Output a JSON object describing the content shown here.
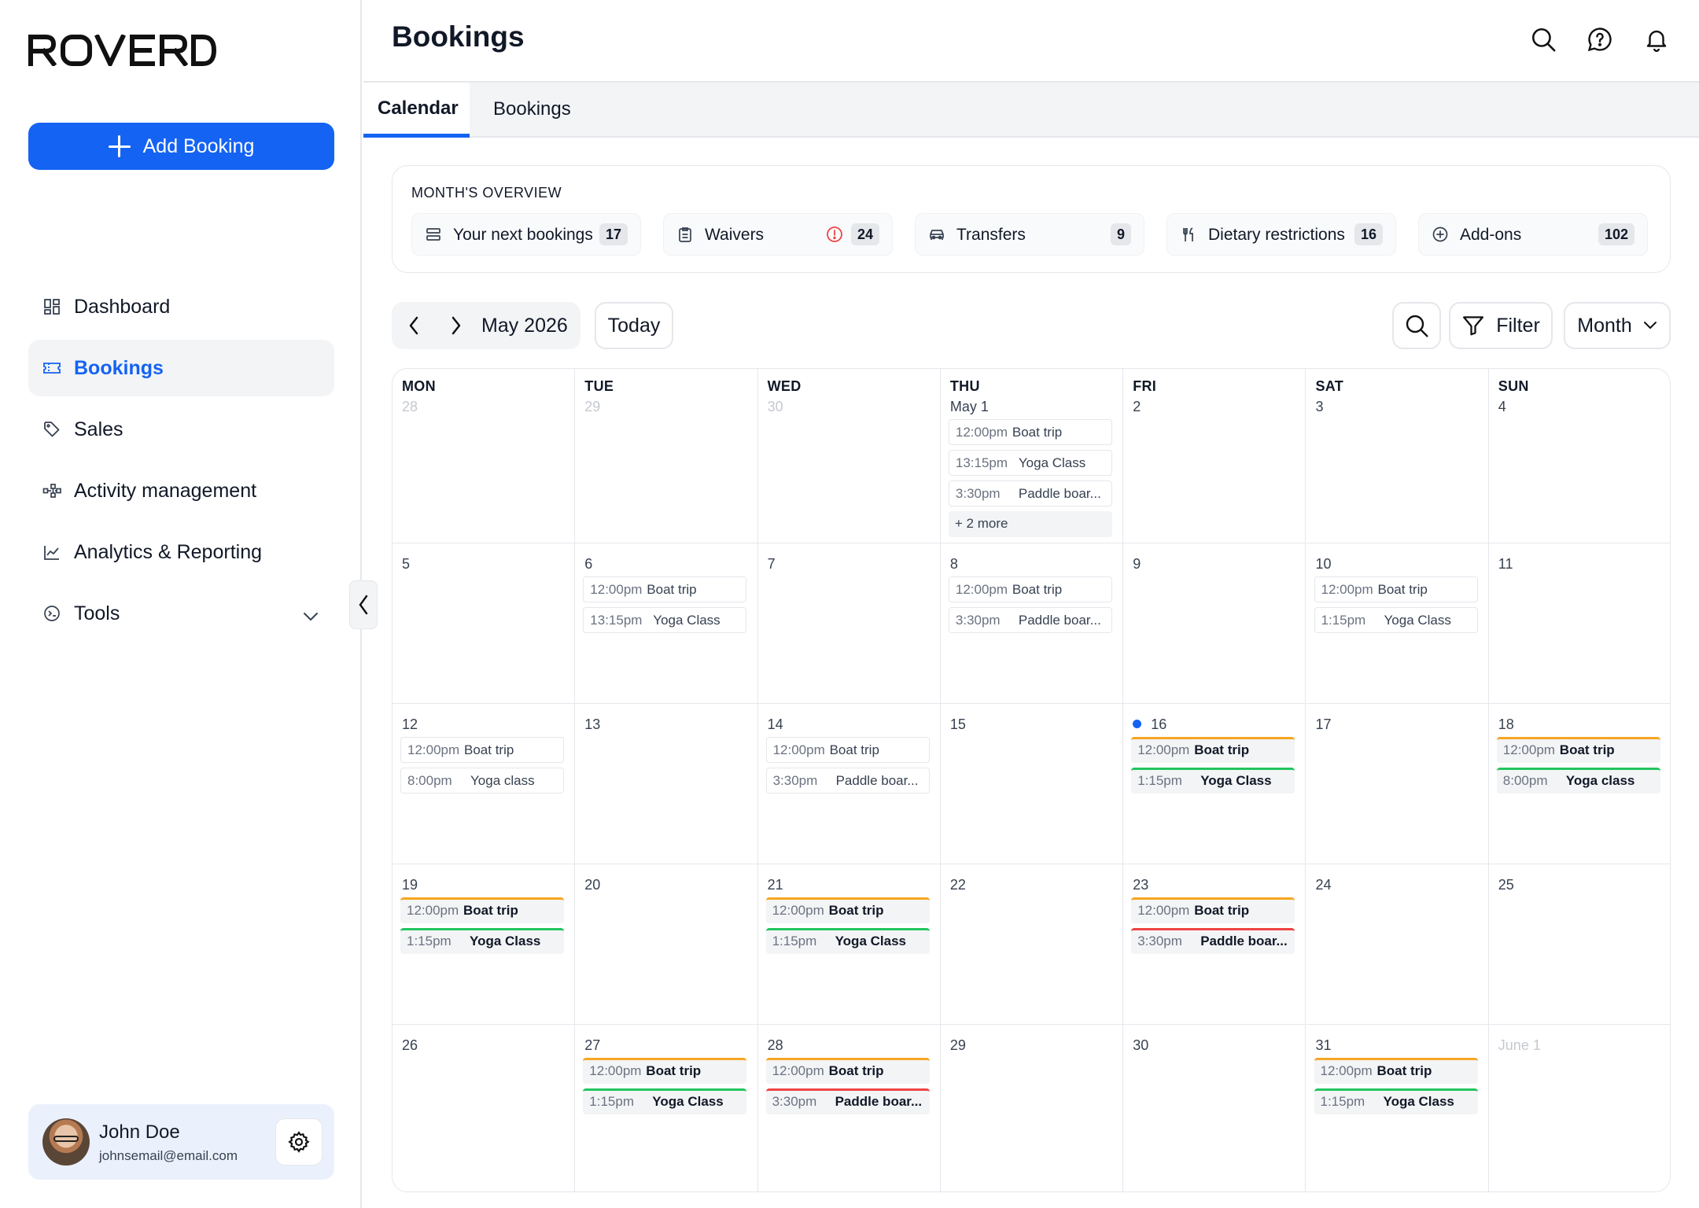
{
  "brand": {
    "logo_text": "ROVERD",
    "accent": "#1463f3"
  },
  "sidebar": {
    "add_button": "Add Booking",
    "items": [
      {
        "label": "Dashboard",
        "icon": "dashboard-icon",
        "active": false
      },
      {
        "label": "Bookings",
        "icon": "ticket-icon",
        "active": true
      },
      {
        "label": "Sales",
        "icon": "tag-icon",
        "active": false
      },
      {
        "label": "Activity management",
        "icon": "activity-icon",
        "active": false
      },
      {
        "label": "Analytics & Reporting",
        "icon": "chart-icon",
        "active": false
      },
      {
        "label": "Tools",
        "icon": "tools-icon",
        "active": false,
        "expandable": true
      }
    ],
    "user": {
      "name": "John Doe",
      "email": "johnsemail@email.com"
    }
  },
  "header": {
    "title": "Bookings",
    "icons": [
      "search-icon",
      "help-icon",
      "bell-icon"
    ]
  },
  "tabs": [
    {
      "label": "Calendar",
      "active": true
    },
    {
      "label": "Bookings",
      "active": false
    }
  ],
  "overview": {
    "title": "MONTH'S OVERVIEW",
    "cards": [
      {
        "label": "Your next bookings",
        "count": "17",
        "icon": "list-icon"
      },
      {
        "label": "Waivers",
        "count": "24",
        "icon": "clipboard-icon",
        "alert": true
      },
      {
        "label": "Transfers",
        "count": "9",
        "icon": "car-icon"
      },
      {
        "label": "Dietary restrictions",
        "count": "16",
        "icon": "utensils-icon"
      },
      {
        "label": "Add-ons",
        "count": "102",
        "icon": "plus-circle-icon"
      }
    ]
  },
  "toolbar": {
    "month": "May 2026",
    "today": "Today",
    "filter": "Filter",
    "view": "Month"
  },
  "colors": {
    "boat_trip": "#f5a623",
    "yoga": "#22c55e",
    "paddle": "#ef4444"
  },
  "calendar": {
    "days_of_week": [
      "MON",
      "TUE",
      "WED",
      "THU",
      "FRI",
      "SAT",
      "SUN"
    ],
    "weeks": [
      [
        {
          "label": "28",
          "muted": true,
          "events": []
        },
        {
          "label": "29",
          "muted": true,
          "events": []
        },
        {
          "label": "30",
          "muted": true,
          "events": []
        },
        {
          "label": "May 1",
          "events": [
            {
              "time": "12:00pm",
              "name": "Boat trip"
            },
            {
              "time": "13:15pm",
              "name": "Yoga Class"
            },
            {
              "time": "3:30pm",
              "name": "Paddle boar..."
            },
            {
              "more": "+ 2 more"
            }
          ]
        },
        {
          "label": "2",
          "events": []
        },
        {
          "label": "3",
          "events": []
        },
        {
          "label": "4",
          "events": []
        }
      ],
      [
        {
          "label": "5",
          "events": []
        },
        {
          "label": "6",
          "events": [
            {
              "time": "12:00pm",
              "name": "Boat trip"
            },
            {
              "time": "13:15pm",
              "name": "Yoga Class"
            }
          ]
        },
        {
          "label": "7",
          "events": []
        },
        {
          "label": "8",
          "events": [
            {
              "time": "12:00pm",
              "name": "Boat trip"
            },
            {
              "time": "3:30pm",
              "name": "Paddle boar..."
            }
          ]
        },
        {
          "label": "9",
          "events": []
        },
        {
          "label": "10",
          "events": [
            {
              "time": "12:00pm",
              "name": "Boat trip"
            },
            {
              "time": "1:15pm",
              "name": "Yoga Class"
            }
          ]
        },
        {
          "label": "11",
          "events": []
        }
      ],
      [
        {
          "label": "12",
          "events": [
            {
              "time": "12:00pm",
              "name": "Boat trip"
            },
            {
              "time": "8:00pm",
              "name": "Yoga class"
            }
          ]
        },
        {
          "label": "13",
          "events": []
        },
        {
          "label": "14",
          "events": [
            {
              "time": "12:00pm",
              "name": "Boat trip"
            },
            {
              "time": "3:30pm",
              "name": "Paddle boar..."
            }
          ]
        },
        {
          "label": "15",
          "events": []
        },
        {
          "label": "16",
          "today": true,
          "events": [
            {
              "time": "12:00pm",
              "name": "Boat trip",
              "color": "boat_trip"
            },
            {
              "time": "1:15pm",
              "name": "Yoga Class",
              "color": "yoga"
            }
          ]
        },
        {
          "label": "17",
          "events": []
        },
        {
          "label": "18",
          "events": [
            {
              "time": "12:00pm",
              "name": "Boat trip",
              "color": "boat_trip"
            },
            {
              "time": "8:00pm",
              "name": "Yoga class",
              "color": "yoga"
            }
          ]
        }
      ],
      [
        {
          "label": "19",
          "events": [
            {
              "time": "12:00pm",
              "name": "Boat trip",
              "color": "boat_trip"
            },
            {
              "time": "1:15pm",
              "name": "Yoga Class",
              "color": "yoga"
            }
          ]
        },
        {
          "label": "20",
          "events": []
        },
        {
          "label": "21",
          "events": [
            {
              "time": "12:00pm",
              "name": "Boat trip",
              "color": "boat_trip"
            },
            {
              "time": "1:15pm",
              "name": "Yoga Class",
              "color": "yoga"
            }
          ]
        },
        {
          "label": "22",
          "events": []
        },
        {
          "label": "23",
          "events": [
            {
              "time": "12:00pm",
              "name": "Boat trip",
              "color": "boat_trip"
            },
            {
              "time": "3:30pm",
              "name": "Paddle boar...",
              "color": "paddle"
            }
          ]
        },
        {
          "label": "24",
          "events": []
        },
        {
          "label": "25",
          "events": []
        }
      ],
      [
        {
          "label": "26",
          "events": []
        },
        {
          "label": "27",
          "events": [
            {
              "time": "12:00pm",
              "name": "Boat trip",
              "color": "boat_trip"
            },
            {
              "time": "1:15pm",
              "name": "Yoga Class",
              "color": "yoga"
            }
          ]
        },
        {
          "label": "28",
          "events": [
            {
              "time": "12:00pm",
              "name": "Boat trip",
              "color": "boat_trip"
            },
            {
              "time": "3:30pm",
              "name": "Paddle boar...",
              "color": "paddle"
            }
          ]
        },
        {
          "label": "29",
          "events": []
        },
        {
          "label": "30",
          "events": []
        },
        {
          "label": "31",
          "events": [
            {
              "time": "12:00pm",
              "name": "Boat trip",
              "color": "boat_trip"
            },
            {
              "time": "1:15pm",
              "name": "Yoga Class",
              "color": "yoga"
            }
          ]
        },
        {
          "label": "June 1",
          "muted": true,
          "events": []
        }
      ]
    ]
  }
}
